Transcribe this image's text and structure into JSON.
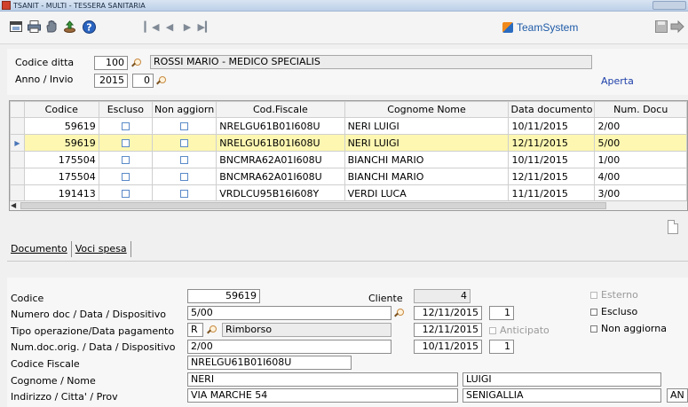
{
  "window": {
    "title": "TSANIT  - MULTI - TESSERA SANITARIA"
  },
  "brand": {
    "name": "TeamSystem"
  },
  "toolbar": {
    "icons": [
      "window-icon",
      "print-icon",
      "hand-icon",
      "export-icon",
      "help-icon"
    ],
    "nav": [
      "first-icon",
      "prev-icon",
      "next-icon",
      "last-icon"
    ]
  },
  "header": {
    "codice_ditta_label": "Codice ditta",
    "codice_ditta_value": "100",
    "ditta_name": "ROSSI MARIO - MEDICO SPECIALIS",
    "anno_label": "Anno / Invio",
    "anno_value": "2015",
    "invio_value": "0",
    "status": "Aperta"
  },
  "grid": {
    "columns": [
      "Codice",
      "Escluso",
      "Non aggiorn",
      "Cod.Fiscale",
      "Cognome Nome",
      "Data documento",
      "Num. Docu"
    ],
    "rows": [
      {
        "codice": "59619",
        "cf": "NRELGU61B01I608U",
        "nome": "NERI LUIGI",
        "data": "10/11/2015",
        "num": "2/00",
        "selected": false
      },
      {
        "codice": "59619",
        "cf": "NRELGU61B01I608U",
        "nome": "NERI LUIGI",
        "data": "12/11/2015",
        "num": "5/00",
        "selected": true
      },
      {
        "codice": "175504",
        "cf": "BNCMRA62A01I608U",
        "nome": "BIANCHI MARIO",
        "data": "10/11/2015",
        "num": "1/00",
        "selected": false
      },
      {
        "codice": "175504",
        "cf": "BNCMRA62A01I608U",
        "nome": "BIANCHI MARIO",
        "data": "12/11/2015",
        "num": "4/00",
        "selected": false
      },
      {
        "codice": "191413",
        "cf": "VRDLCU95B16I608Y",
        "nome": "VERDI LUCA",
        "data": "11/11/2015",
        "num": "3/00",
        "selected": false
      }
    ]
  },
  "tabs": {
    "documento": "Documento",
    "voci_spesa": "Voci spesa"
  },
  "form": {
    "codice_label": "Codice",
    "codice_value": "59619",
    "cliente_label": "Cliente",
    "cliente_value": "4",
    "numero_label": "Numero doc / Data / Dispositivo",
    "numero_value": "5/00",
    "numero_data": "12/11/2015",
    "numero_disp": "1",
    "tipo_label": "Tipo operazione/Data pagamento",
    "tipo_code": "R",
    "tipo_desc": "Rimborso",
    "tipo_data": "12/11/2015",
    "anticipato_label": "Anticipato",
    "orig_label": "Num.doc.orig. / Data / Dispositivo",
    "orig_value": "2/00",
    "orig_data": "10/11/2015",
    "orig_disp": "1",
    "cf_label": "Codice Fiscale",
    "cf_value": "NRELGU61B01I608U",
    "cognome_label": "Cognome / Nome",
    "cognome_value": "NERI",
    "nome_value": "LUIGI",
    "indirizzo_label": "Indirizzo / Citta' / Prov",
    "indirizzo_value": "VIA MARCHE 54",
    "citta_value": "SENIGALLIA",
    "prov_value": "AN",
    "esterno_label": "Esterno",
    "escluso_label": "Escluso",
    "non_aggiorna_label": "Non aggiorna"
  }
}
